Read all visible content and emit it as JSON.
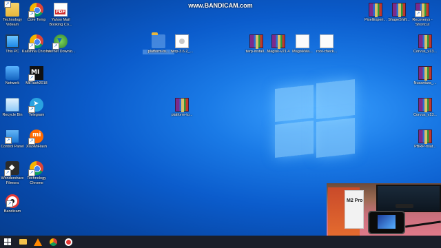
{
  "watermark": "www.BANDICAM.com",
  "left_icons": [
    {
      "label": "Technology Videam",
      "icon": "folder-icon",
      "cls": "folder shortcut"
    },
    {
      "label": "Core Temp",
      "icon": "core-temp-icon",
      "cls": "chrome shortcut"
    },
    {
      "label": "Yahoo Mail Booking Co...",
      "icon": "pdf-icon",
      "cls": "pdf"
    },
    {
      "label": "This PC",
      "icon": "this-pc-icon",
      "cls": "pc"
    },
    {
      "label": "Kalishna Chrome",
      "icon": "chrome-icon",
      "cls": "chrome shortcut"
    },
    {
      "label": "Internet Downlo...",
      "icon": "idm-icon",
      "cls": "idm shortcut"
    },
    {
      "label": "Network",
      "icon": "network-icon",
      "cls": "network"
    },
    {
      "label": "MiFlash2018",
      "icon": "mi-flash-icon",
      "cls": "mi shortcut"
    },
    {
      "label": "Recycle Bin",
      "icon": "recycle-bin-icon",
      "cls": "bin"
    },
    {
      "label": "Telegram",
      "icon": "telegram-icon",
      "cls": "telegram shortcut"
    },
    {
      "label": "Control Panel",
      "icon": "control-panel-icon",
      "cls": "control shortcut"
    },
    {
      "label": "XiaoMiFlash",
      "icon": "xiaomi-icon",
      "cls": "xiaomi shortcut"
    },
    {
      "label": "Wondershare Filmora",
      "icon": "wondershare-icon",
      "cls": "wondershare shortcut"
    },
    {
      "label": "Technology Chrome",
      "icon": "chrome-icon",
      "cls": "chrome shortcut"
    },
    {
      "label": "Bandicam",
      "icon": "bandicam-icon",
      "cls": "bandicam shortcut"
    }
  ],
  "middle_icons": [
    {
      "label": "platform-to...",
      "icon": "folder-icon",
      "cls": "folder",
      "selected": true
    },
    {
      "label": "twrp-3.6.2_...",
      "icon": "image-file-icon",
      "cls": "docimg"
    },
    {
      "label": "platform-to...",
      "icon": "winrar-archive-icon",
      "cls": "rar"
    },
    {
      "label": "twrp-install...",
      "icon": "winrar-archive-icon",
      "cls": "rar"
    },
    {
      "label": "Magisk-v21.4",
      "icon": "winrar-archive-icon",
      "cls": "rar"
    },
    {
      "label": "MagiskMa...",
      "icon": "file-icon",
      "cls": "file"
    },
    {
      "label": "root-check...",
      "icon": "file-icon",
      "cls": "file"
    }
  ],
  "right_icons": [
    {
      "label": "PixelExperi...",
      "icon": "winrar-archive-icon",
      "cls": "rar"
    },
    {
      "label": "ShapeShift...",
      "icon": "winrar-archive-icon",
      "cls": "rar"
    },
    {
      "label": "Recoverys - Shortcut",
      "icon": "winrar-archive-icon",
      "cls": "rar shortcut"
    },
    {
      "label": "Corvus_v13...",
      "icon": "winrar-archive-icon",
      "cls": "rar"
    },
    {
      "label": "Nusantara_...",
      "icon": "winrar-archive-icon",
      "cls": "rar"
    },
    {
      "label": "Corvus_v13...",
      "icon": "winrar-archive-icon",
      "cls": "rar"
    },
    {
      "label": "PBRP-miat...",
      "icon": "winrar-archive-icon",
      "cls": "rar"
    }
  ],
  "webcam": {
    "box_label": "M2 Pro"
  },
  "taskbar": [
    {
      "name": "start-button",
      "cls": "start"
    },
    {
      "name": "file-explorer-taskbar-icon",
      "cls": "tb-explorer"
    },
    {
      "name": "vlc-taskbar-icon",
      "cls": "tb-vlc"
    },
    {
      "name": "chrome-taskbar-icon",
      "cls": "tb-chrome"
    },
    {
      "name": "bandicam-taskbar-icon",
      "cls": "tb-bandicam"
    }
  ]
}
